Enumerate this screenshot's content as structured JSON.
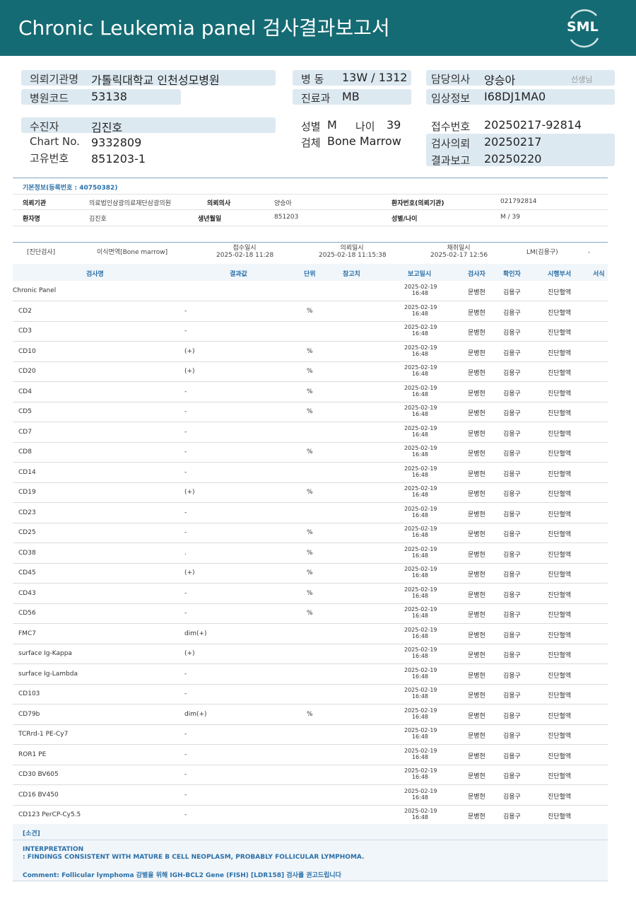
{
  "header": {
    "title": "Chronic  Leukemia  panel 검사결과보고서",
    "logo": "SML"
  },
  "patient_block": {
    "req_org_label": "의뢰기관명",
    "req_org": "가톨릭대학교 인천성모병원",
    "ward_label": "병  동",
    "ward": "13W / 1312",
    "doctor_label": "담당의사",
    "doctor": "양승아",
    "doctor_suffix": "선생님",
    "hosp_code_label": "병원코드",
    "hosp_code": "53138",
    "dept_label": "진료과",
    "dept": "MB",
    "clinical_label": "임상정보",
    "clinical": "I68DJ1MA0",
    "patient_label": "수진자",
    "patient": "김진호",
    "sex_label": "성별",
    "sex": "M",
    "age_label": "나이",
    "age": "39",
    "receipt_label": "접수번호",
    "receipt": "20250217-92814",
    "chart_label": "Chart No.",
    "chart": "9332809",
    "specimen_label": "검체",
    "specimen": "Bone Marrow",
    "req_date_label": "검사의뢰",
    "req_date": "20250217",
    "uid_label": "고유번호",
    "uid": "851203-1",
    "report_date_label": "결과보고",
    "report_date": "20250220"
  },
  "basic_info": {
    "title": "기본정보(등록번호 : 40750382)",
    "org_label": "의뢰기관",
    "org": "의료법인삼광의료재단삼광의원",
    "doctor_label": "의뢰의사",
    "doctor": "양승아",
    "pt_no_label": "환자번호(의뢰기관)",
    "pt_no": "021792814",
    "name_label": "환자명",
    "name": "김진호",
    "dob_label": "생년월일",
    "dob": "851203",
    "sexage_label": "성별/나이",
    "sexage": "M / 39"
  },
  "diagnosis": {
    "category": "[진단검사]",
    "test": "이식면역[Bone marrow]",
    "recv_label": "접수일시",
    "recv": "2025-02-18 11:28",
    "req_label": "의뢰일시",
    "req": "2025-02-18 11:15:38",
    "col_label": "채취일시",
    "col": "2025-02-17 12:56",
    "lm": "LM(김용구)",
    "dash": "-"
  },
  "table": {
    "headers": [
      "검사명",
      "결과값",
      "단위",
      "참고치",
      "보고일시",
      "검사자",
      "확인자",
      "시행부서",
      "서식"
    ],
    "rows": [
      {
        "name": "Chronic Panel",
        "result": "",
        "unit": "",
        "date": "2025-02-19",
        "time": "16:48",
        "tech": "문병현",
        "conf": "김용구",
        "dept": "진단혈액"
      },
      {
        "name": "CD2",
        "result": "-",
        "unit": "%",
        "date": "2025-02-19",
        "time": "16:48",
        "tech": "문병현",
        "conf": "김용구",
        "dept": "진단혈액"
      },
      {
        "name": "CD3",
        "result": "-",
        "unit": "",
        "date": "2025-02-19",
        "time": "16:48",
        "tech": "문병현",
        "conf": "김용구",
        "dept": "진단혈액"
      },
      {
        "name": "CD10",
        "result": "(+)",
        "unit": "%",
        "date": "2025-02-19",
        "time": "16:48",
        "tech": "문병현",
        "conf": "김용구",
        "dept": "진단혈액"
      },
      {
        "name": "CD20",
        "result": "(+)",
        "unit": "%",
        "date": "2025-02-19",
        "time": "16:48",
        "tech": "문병현",
        "conf": "김용구",
        "dept": "진단혈액"
      },
      {
        "name": "CD4",
        "result": "-",
        "unit": "%",
        "date": "2025-02-19",
        "time": "16:48",
        "tech": "문병현",
        "conf": "김용구",
        "dept": "진단혈액"
      },
      {
        "name": "CD5",
        "result": "-",
        "unit": "%",
        "date": "2025-02-19",
        "time": "16:48",
        "tech": "문병현",
        "conf": "김용구",
        "dept": "진단혈액"
      },
      {
        "name": "CD7",
        "result": "-",
        "unit": "",
        "date": "2025-02-19",
        "time": "16:48",
        "tech": "문병현",
        "conf": "김용구",
        "dept": "진단혈액"
      },
      {
        "name": "CD8",
        "result": "-",
        "unit": "%",
        "date": "2025-02-19",
        "time": "16:48",
        "tech": "문병현",
        "conf": "김용구",
        "dept": "진단혈액"
      },
      {
        "name": "CD14",
        "result": "-",
        "unit": "",
        "date": "2025-02-19",
        "time": "16:48",
        "tech": "문병현",
        "conf": "김용구",
        "dept": "진단혈액"
      },
      {
        "name": "CD19",
        "result": "(+)",
        "unit": "%",
        "date": "2025-02-19",
        "time": "16:48",
        "tech": "문병현",
        "conf": "김용구",
        "dept": "진단혈액"
      },
      {
        "name": "CD23",
        "result": "-",
        "unit": "",
        "date": "2025-02-19",
        "time": "16:48",
        "tech": "문병현",
        "conf": "김용구",
        "dept": "진단혈액"
      },
      {
        "name": "CD25",
        "result": "-",
        "unit": "%",
        "date": "2025-02-19",
        "time": "16:48",
        "tech": "문병현",
        "conf": "김용구",
        "dept": "진단혈액"
      },
      {
        "name": "CD38",
        "result": ".",
        "unit": "%",
        "date": "2025-02-19",
        "time": "16:48",
        "tech": "문병현",
        "conf": "김용구",
        "dept": "진단혈액"
      },
      {
        "name": "CD45",
        "result": "(+)",
        "unit": "%",
        "date": "2025-02-19",
        "time": "16:48",
        "tech": "문병현",
        "conf": "김용구",
        "dept": "진단혈액"
      },
      {
        "name": "CD43",
        "result": "-",
        "unit": "%",
        "date": "2025-02-19",
        "time": "16:48",
        "tech": "문병현",
        "conf": "김용구",
        "dept": "진단혈액"
      },
      {
        "name": "CD56",
        "result": "-",
        "unit": "%",
        "date": "2025-02-19",
        "time": "16:48",
        "tech": "문병현",
        "conf": "김용구",
        "dept": "진단혈액"
      },
      {
        "name": "FMC7",
        "result": "dim(+)",
        "unit": "",
        "date": "2025-02-19",
        "time": "16:48",
        "tech": "문병현",
        "conf": "김용구",
        "dept": "진단혈액"
      },
      {
        "name": "surface Ig-Kappa",
        "result": "(+)",
        "unit": "",
        "date": "2025-02-19",
        "time": "16:48",
        "tech": "문병현",
        "conf": "김용구",
        "dept": "진단혈액"
      },
      {
        "name": "surface Ig-Lambda",
        "result": "-",
        "unit": "",
        "date": "2025-02-19",
        "time": "16:48",
        "tech": "문병현",
        "conf": "김용구",
        "dept": "진단혈액"
      },
      {
        "name": "CD103",
        "result": "-",
        "unit": "",
        "date": "2025-02-19",
        "time": "16:48",
        "tech": "문병현",
        "conf": "김용구",
        "dept": "진단혈액"
      },
      {
        "name": "CD79b",
        "result": "dim(+)",
        "unit": "%",
        "date": "2025-02-19",
        "time": "16:48",
        "tech": "문병현",
        "conf": "김용구",
        "dept": "진단혈액"
      },
      {
        "name": "TCRrd-1 PE-Cy7",
        "result": "-",
        "unit": "",
        "date": "2025-02-19",
        "time": "16:48",
        "tech": "문병현",
        "conf": "김용구",
        "dept": "진단혈액"
      },
      {
        "name": "ROR1 PE",
        "result": "-",
        "unit": "",
        "date": "2025-02-19",
        "time": "16:48",
        "tech": "문병현",
        "conf": "김용구",
        "dept": "진단혈액"
      },
      {
        "name": "CD30 BV605",
        "result": "-",
        "unit": "",
        "date": "2025-02-19",
        "time": "16:48",
        "tech": "문병현",
        "conf": "김용구",
        "dept": "진단혈액"
      },
      {
        "name": "CD16 BV450",
        "result": "-",
        "unit": "",
        "date": "2025-02-19",
        "time": "16:48",
        "tech": "문병현",
        "conf": "김용구",
        "dept": "진단혈액"
      },
      {
        "name": "CD123 PerCP-Cy5.5",
        "result": "-",
        "unit": "",
        "date": "2025-02-19",
        "time": "16:48",
        "tech": "문병현",
        "conf": "김용구",
        "dept": "진단혈액"
      }
    ]
  },
  "findings": {
    "title": "[소견]",
    "interp_title": "INTERPRETATION",
    "interp": ": FINDINGS CONSISTENT WITH MATURE B CELL NEOPLASM, PROBABLY FOLLICULAR LYMPHOMA.",
    "comment": "Comment: Follicular lymphoma 감별을 위해 IGH-BCL2 Gene (FISH) [LDR158] 검사를 권고드립니다"
  }
}
